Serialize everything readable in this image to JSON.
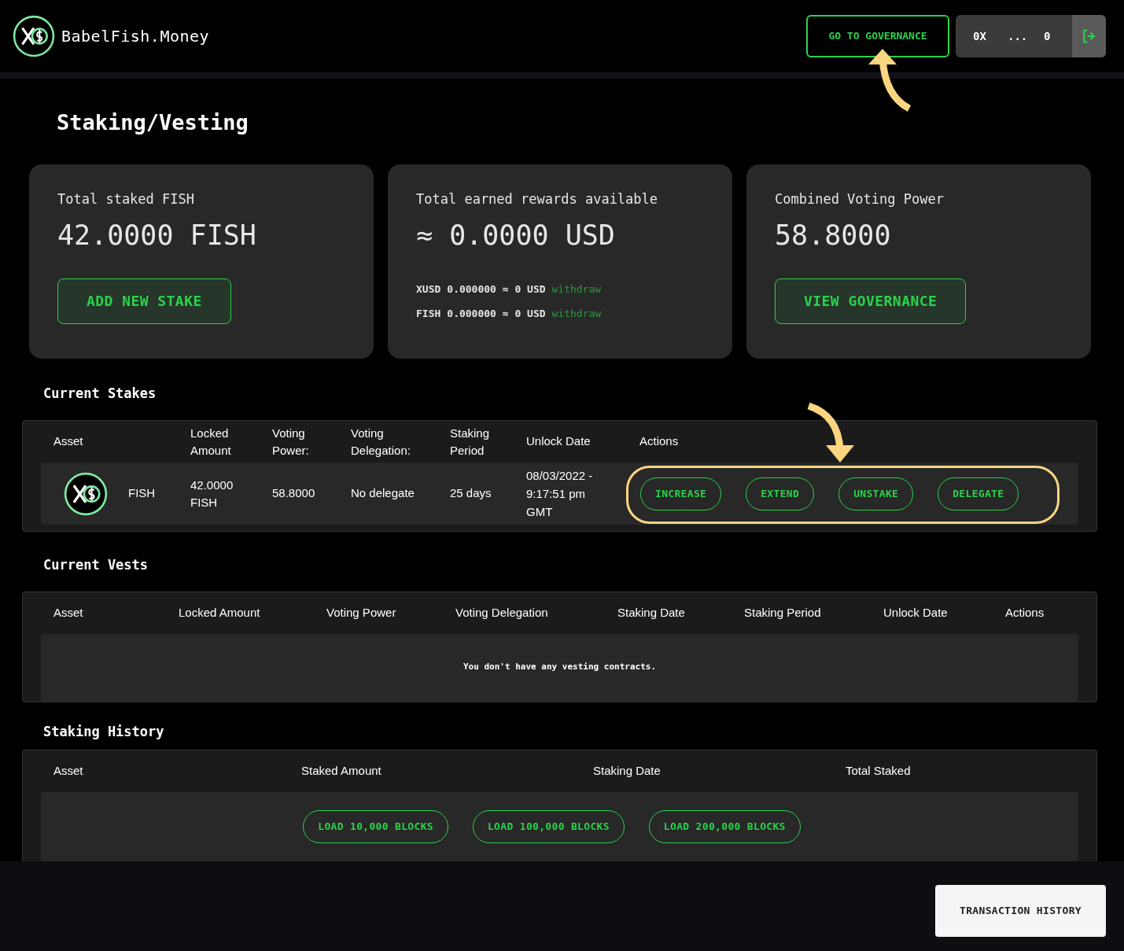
{
  "header": {
    "brand": "BabelFish.Money",
    "governance_button": "GO TO GOVERNANCE",
    "wallet": {
      "prefix": "0X",
      "ellipsis": "...",
      "suffix": "0"
    }
  },
  "page_title": "Staking/Vesting",
  "cards": [
    {
      "kind": "stake",
      "title": "Total staked FISH",
      "value": "42.0000 FISH",
      "button": "ADD NEW STAKE"
    },
    {
      "kind": "rewards",
      "title": "Total earned rewards available",
      "value": "≈ 0.0000 USD",
      "rewards": [
        {
          "asset": "XUSD",
          "amount": "0.000000 ≈ 0 USD",
          "link": "withdraw"
        },
        {
          "asset": "FISH",
          "amount": "0.000000 ≈ 0 USD",
          "link": "withdraw"
        }
      ]
    },
    {
      "kind": "voting",
      "title": "Combined Voting Power",
      "value": "58.8000",
      "button": "VIEW GOVERNANCE"
    }
  ],
  "current_stakes": {
    "title": "Current Stakes",
    "columns": [
      "Asset",
      "Locked Amount",
      "Voting Power:",
      "Voting Delegation:",
      "Staking Period",
      "Unlock Date",
      "Actions"
    ],
    "rows": [
      {
        "asset": "FISH",
        "locked": "42.0000 FISH",
        "voting_power": "58.8000",
        "delegation": "No delegate",
        "period": "25 days",
        "unlock": "08/03/2022 - 9:17:51 pm GMT",
        "actions": [
          "INCREASE",
          "EXTEND",
          "UNSTAKE",
          "DELEGATE"
        ]
      }
    ]
  },
  "current_vests": {
    "title": "Current Vests",
    "columns": [
      "Asset",
      "Locked Amount",
      "Voting Power",
      "Voting Delegation",
      "Staking Date",
      "Staking Period",
      "Unlock Date",
      "Actions"
    ],
    "empty_message": "You don't have any vesting contracts."
  },
  "staking_history": {
    "title": "Staking History",
    "columns": [
      "Asset",
      "Staked Amount",
      "Staking Date",
      "Total Staked"
    ],
    "load_buttons": [
      "LOAD 10,000 BLOCKS",
      "LOAD 100,000 BLOCKS",
      "LOAD 200,000 BLOCKS"
    ]
  },
  "transaction_history_button": "TRANSACTION HISTORY"
}
